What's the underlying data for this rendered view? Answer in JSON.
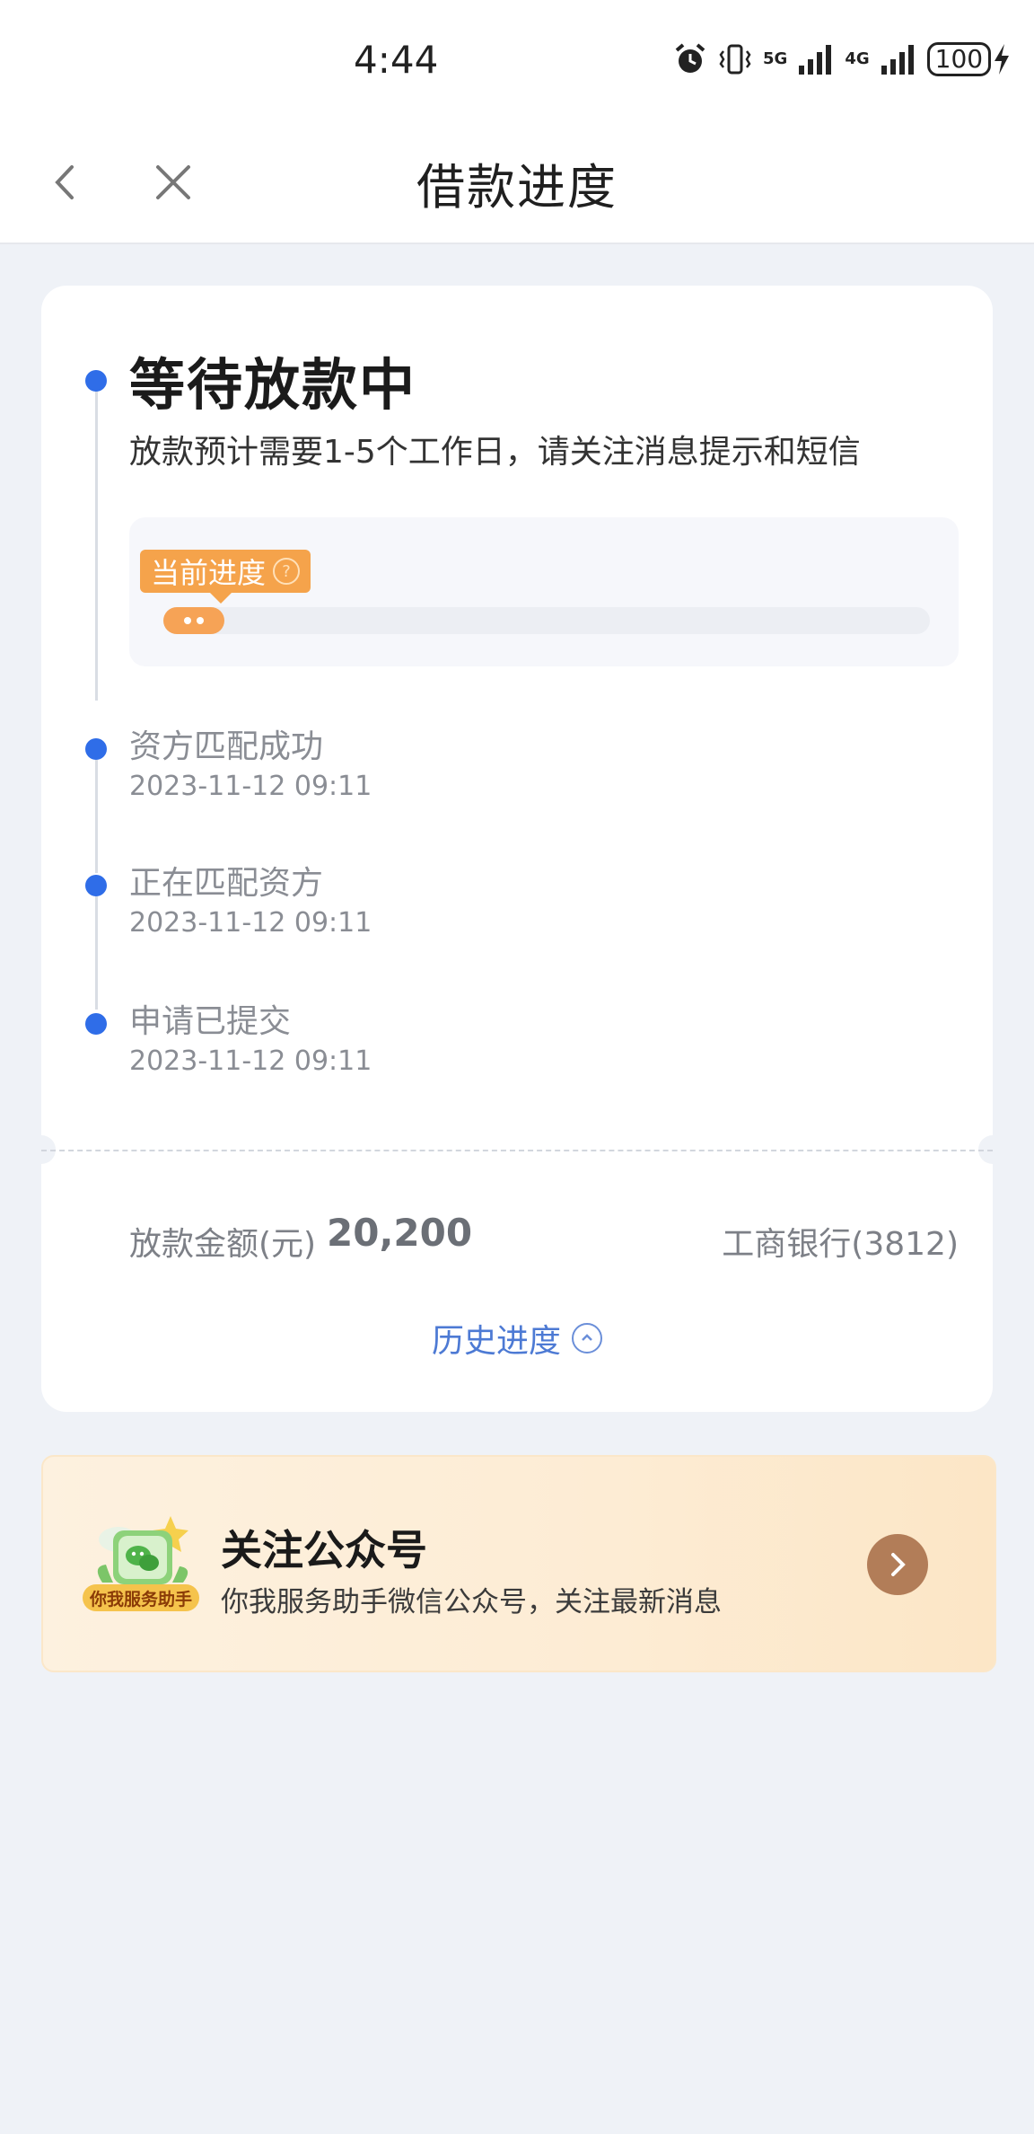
{
  "status_bar": {
    "time": "4:44",
    "battery": "100",
    "network_5g": "5G",
    "network_4g": "4G"
  },
  "nav": {
    "title": "借款进度",
    "back_icon": "chevron-left-icon",
    "close_icon": "close-icon"
  },
  "loan_status": {
    "current_title": "等待放款中",
    "current_desc": "放款预计需要1-5个工作日，请关注消息提示和短信",
    "progress_tag": "当前进度",
    "progress_percent": 8
  },
  "timeline": [
    {
      "title": "资方匹配成功",
      "time": "2023-11-12 09:11"
    },
    {
      "title": "正在匹配资方",
      "time": "2023-11-12 09:11"
    },
    {
      "title": "申请已提交",
      "time": "2023-11-12 09:11"
    }
  ],
  "amount": {
    "label": "放款金额(元)",
    "value": "20,200",
    "bank": "工商银行(3812)"
  },
  "history": {
    "label": "历史进度"
  },
  "promo": {
    "logo_text": "你我服务助手",
    "title": "关注公众号",
    "subtitle": "你我服务助手微信公众号，关注最新消息"
  },
  "colors": {
    "accent_blue": "#2f6de8",
    "progress_orange": "#f6a356",
    "promo_arrow": "#b27d58"
  }
}
